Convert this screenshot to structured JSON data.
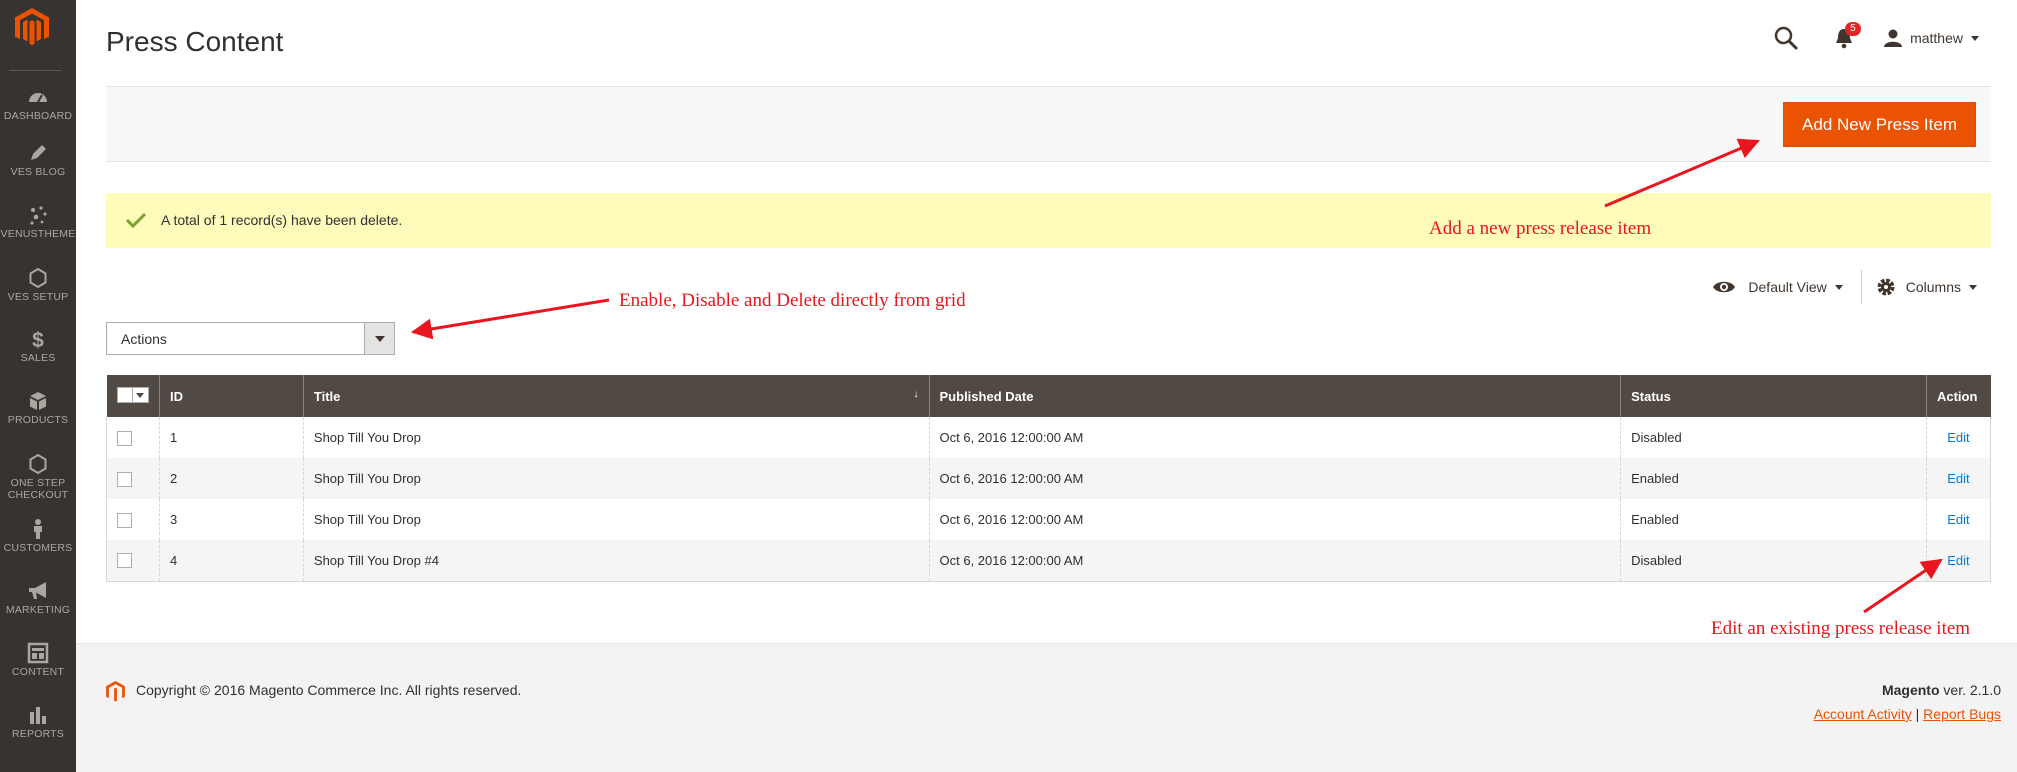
{
  "sidebar": {
    "items": [
      {
        "label": "DASHBOARD",
        "icon": "dashboard-icon"
      },
      {
        "label": "VES BLOG",
        "icon": "pencil-icon"
      },
      {
        "label": "VENUSTHEME",
        "icon": "sparkle-icon"
      },
      {
        "label": "VES SETUP",
        "icon": "hexagon-icon"
      },
      {
        "label": "SALES",
        "icon": "dollar-icon"
      },
      {
        "label": "PRODUCTS",
        "icon": "cube-icon"
      },
      {
        "label": "ONE STEP",
        "label2": "CHECKOUT",
        "icon": "hexagon-icon"
      },
      {
        "label": "CUSTOMERS",
        "icon": "person-icon"
      },
      {
        "label": "MARKETING",
        "icon": "megaphone-icon"
      },
      {
        "label": "CONTENT",
        "icon": "content-icon"
      },
      {
        "label": "REPORTS",
        "icon": "bar-chart-icon"
      }
    ]
  },
  "header": {
    "title": "Press Content",
    "notifications_count": "5",
    "user_name": "matthew"
  },
  "toolbar": {
    "add_button_label": "Add New Press Item"
  },
  "message": {
    "text": "A total of 1 record(s) have been delete."
  },
  "grid_controls": {
    "view_label": "Default View",
    "columns_label": "Columns",
    "actions_label": "Actions"
  },
  "grid": {
    "columns": [
      "ID",
      "Title",
      "Published Date",
      "Status",
      "Action"
    ],
    "rows": [
      {
        "id": "1",
        "title": "Shop Till You Drop",
        "date": "Oct 6, 2016 12:00:00 AM",
        "status": "Disabled",
        "action": "Edit"
      },
      {
        "id": "2",
        "title": "Shop Till You Drop",
        "date": "Oct 6, 2016 12:00:00 AM",
        "status": "Enabled",
        "action": "Edit"
      },
      {
        "id": "3",
        "title": "Shop Till You Drop",
        "date": "Oct 6, 2016 12:00:00 AM",
        "status": "Enabled",
        "action": "Edit"
      },
      {
        "id": "4",
        "title": "Shop Till You Drop #4",
        "date": "Oct 6, 2016 12:00:00 AM",
        "status": "Disabled",
        "action": "Edit"
      }
    ]
  },
  "footer": {
    "copyright": "Copyright © 2016 Magento Commerce Inc. All rights reserved.",
    "brand": "Magento",
    "version": " ver. 2.1.0",
    "account_activity": "Account Activity",
    "separator": "|",
    "report_bugs": "Report Bugs"
  },
  "annotations": {
    "add_note": "Add a new press release item",
    "grid_note": "Enable, Disable and Delete directly from grid",
    "edit_note": "Edit an existing press release item"
  },
  "colors": {
    "sidebar": "#373330",
    "accent": "#eb5202",
    "grid_header": "#514943",
    "message_bg": "#fffbbb",
    "annotation": "#e8161e",
    "link": "#007bdb"
  }
}
